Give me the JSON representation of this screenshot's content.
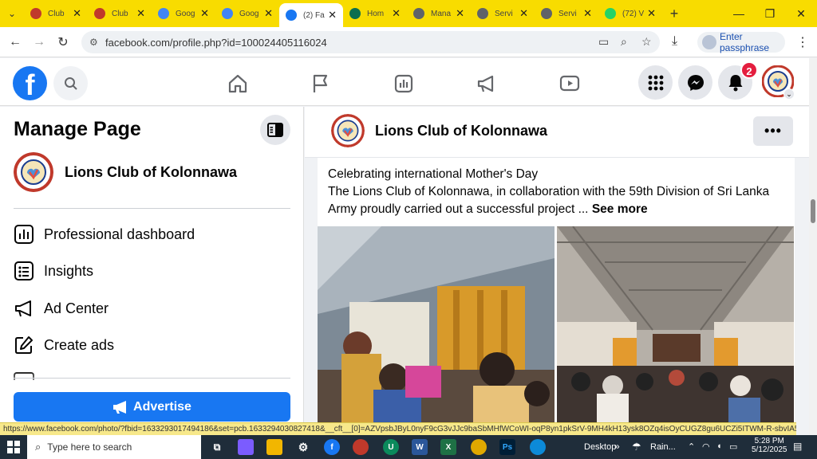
{
  "browser": {
    "tabs": [
      {
        "label": "Club",
        "color": "#c0392b"
      },
      {
        "label": "Club",
        "color": "#c0392b"
      },
      {
        "label": "Goog",
        "color": "#4285f4"
      },
      {
        "label": "Goog",
        "color": "#4285f4"
      },
      {
        "label": "(2) Fa",
        "color": "#1877f2",
        "active": true
      },
      {
        "label": "Hom",
        "color": "#0b6e4f"
      },
      {
        "label": "Mana",
        "color": "#5f6368"
      },
      {
        "label": "Servi",
        "color": "#5f6368"
      },
      {
        "label": "Servi",
        "color": "#5f6368"
      },
      {
        "label": "(72) V",
        "color": "#25d366"
      }
    ],
    "url": "facebook.com/profile.php?id=100024405116024",
    "passphrase_label": "Enter passphrase"
  },
  "facebook": {
    "notification_count": "2",
    "sidebar": {
      "title": "Manage Page",
      "page_name": "Lions Club of Kolonnawa",
      "items": [
        {
          "label": "Professional dashboard",
          "icon": "dashboard-icon"
        },
        {
          "label": "Insights",
          "icon": "insights-icon"
        },
        {
          "label": "Ad Center",
          "icon": "megaphone-icon"
        },
        {
          "label": "Create ads",
          "icon": "edit-icon"
        }
      ],
      "advertise_label": "Advertise"
    },
    "post": {
      "page_name": "Lions Club of Kolonnawa",
      "line1": "Celebrating international Mother's Day",
      "line2": "The Lions Club of Kolonnawa, in collaboration with the 59th Division of Sri Lanka Army proudly carried out a successful project ...",
      "see_more": "See more"
    }
  },
  "status_url": "https://www.facebook.com/photo/?fbid=1633293017494186&set=pcb.1633294030827418&__cft__[0]=AZVpsbJByL0nyF9cG3vJJc9baSbMHfWCoWI-oqP8yn1pkSrV-9MH4kH13ysk8OZq4isOyCUGZ8gu6UCZi5ITWM-R-sbvIA5MjwAIS44jEn-OR...",
  "taskbar": {
    "search_placeholder": "Type here to search",
    "desktop_label": "Desktop",
    "weather": "Rain...",
    "time": "5:28 PM",
    "date": "5/12/2025"
  },
  "colors": {
    "fb_blue": "#1877f2",
    "chrome_yellow": "#f8dc00",
    "badge_red": "#e41e3f"
  }
}
